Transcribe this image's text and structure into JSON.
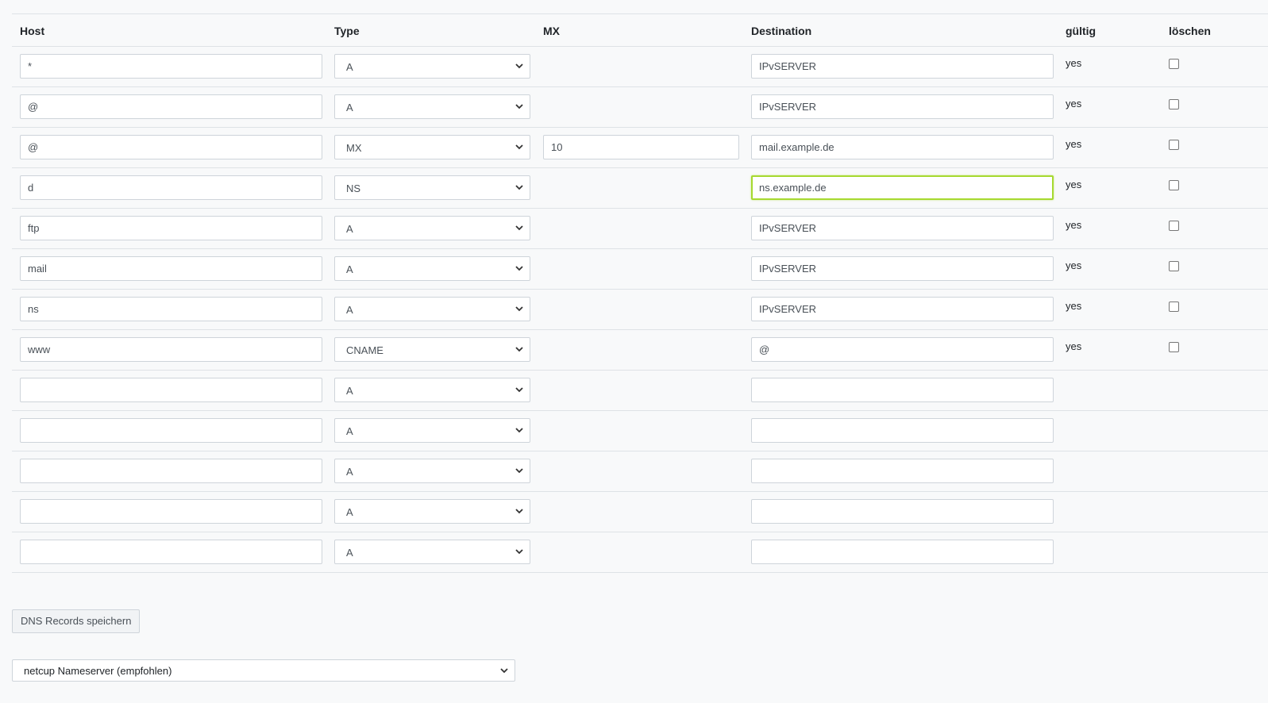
{
  "table": {
    "headers": {
      "host": "Host",
      "type": "Type",
      "mx": "MX",
      "destination": "Destination",
      "valid": "gültig",
      "delete": "löschen"
    },
    "records": [
      {
        "host": "*",
        "type": "A",
        "mx": null,
        "destination": "IPvSERVER",
        "valid": "yes"
      },
      {
        "host": "@",
        "type": "A",
        "mx": null,
        "destination": "IPvSERVER",
        "valid": "yes"
      },
      {
        "host": "@",
        "type": "MX",
        "mx": "10",
        "destination": "mail.example.de",
        "valid": "yes"
      },
      {
        "host": "d",
        "type": "NS",
        "mx": null,
        "destination": "ns.example.de",
        "valid": "yes",
        "focused": true
      },
      {
        "host": "ftp",
        "type": "A",
        "mx": null,
        "destination": "IPvSERVER",
        "valid": "yes"
      },
      {
        "host": "mail",
        "type": "A",
        "mx": null,
        "destination": "IPvSERVER",
        "valid": "yes"
      },
      {
        "host": "ns",
        "type": "A",
        "mx": null,
        "destination": "IPvSERVER",
        "valid": "yes"
      },
      {
        "host": "www",
        "type": "CNAME",
        "mx": null,
        "destination": "@",
        "valid": "yes"
      },
      {
        "host": "",
        "type": "A",
        "mx": null,
        "destination": "",
        "valid": ""
      },
      {
        "host": "",
        "type": "A",
        "mx": null,
        "destination": "",
        "valid": ""
      },
      {
        "host": "",
        "type": "A",
        "mx": null,
        "destination": "",
        "valid": ""
      },
      {
        "host": "",
        "type": "A",
        "mx": null,
        "destination": "",
        "valid": ""
      },
      {
        "host": "",
        "type": "A",
        "mx": null,
        "destination": "",
        "valid": ""
      }
    ]
  },
  "save_button_label": "DNS Records speichern",
  "nameserver_select": {
    "selected": "netcup Nameserver (empfohlen)"
  },
  "icons": {
    "select_arrow": "chevron-down-icon",
    "delete_box": "checkbox-icon"
  },
  "colors": {
    "focus_border": "#a6d930",
    "border": "#ced4da",
    "background": "#f8f9fa"
  }
}
